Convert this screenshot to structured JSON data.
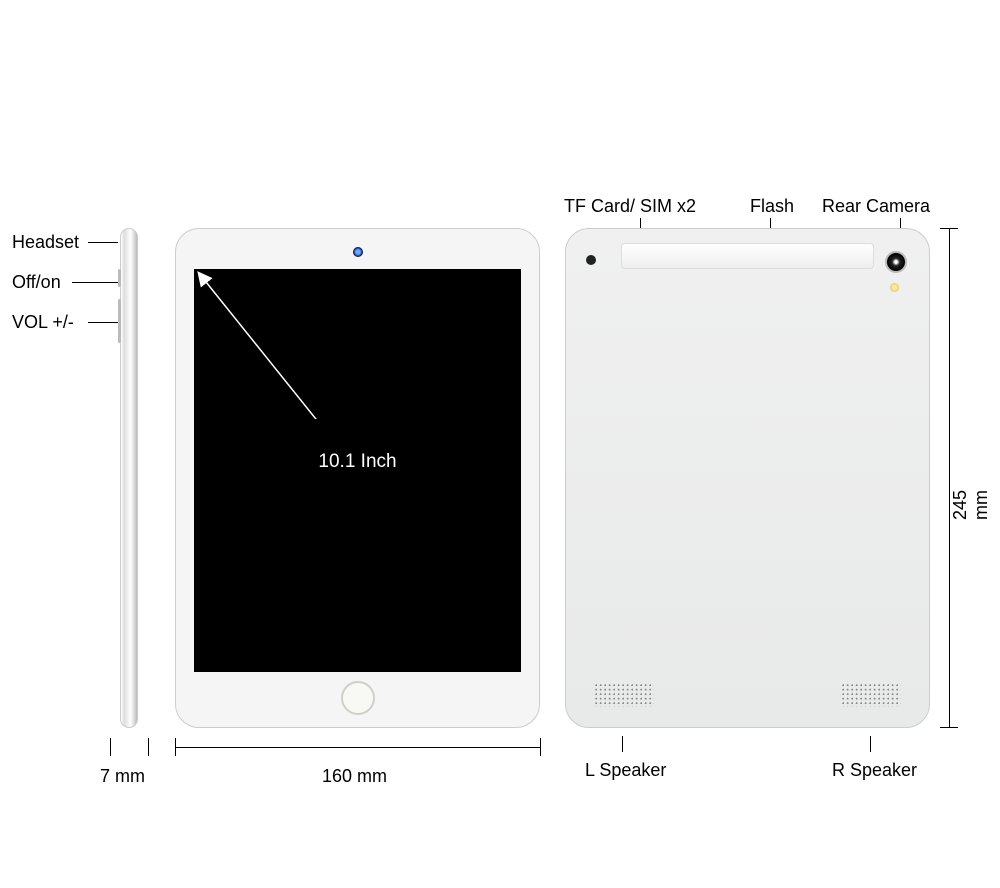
{
  "labels": {
    "headset": "Headset",
    "offon": "Off/on",
    "vol": "VOL +/-",
    "tf_sim": "TF Card/ SIM x2",
    "flash": "Flash",
    "rear_camera": "Rear Camera",
    "l_speaker": "L Speaker",
    "r_speaker": "R Speaker"
  },
  "dimensions": {
    "thickness": "7 mm",
    "width": "160 mm",
    "height": "245 mm",
    "screen": "10.1 Inch"
  }
}
